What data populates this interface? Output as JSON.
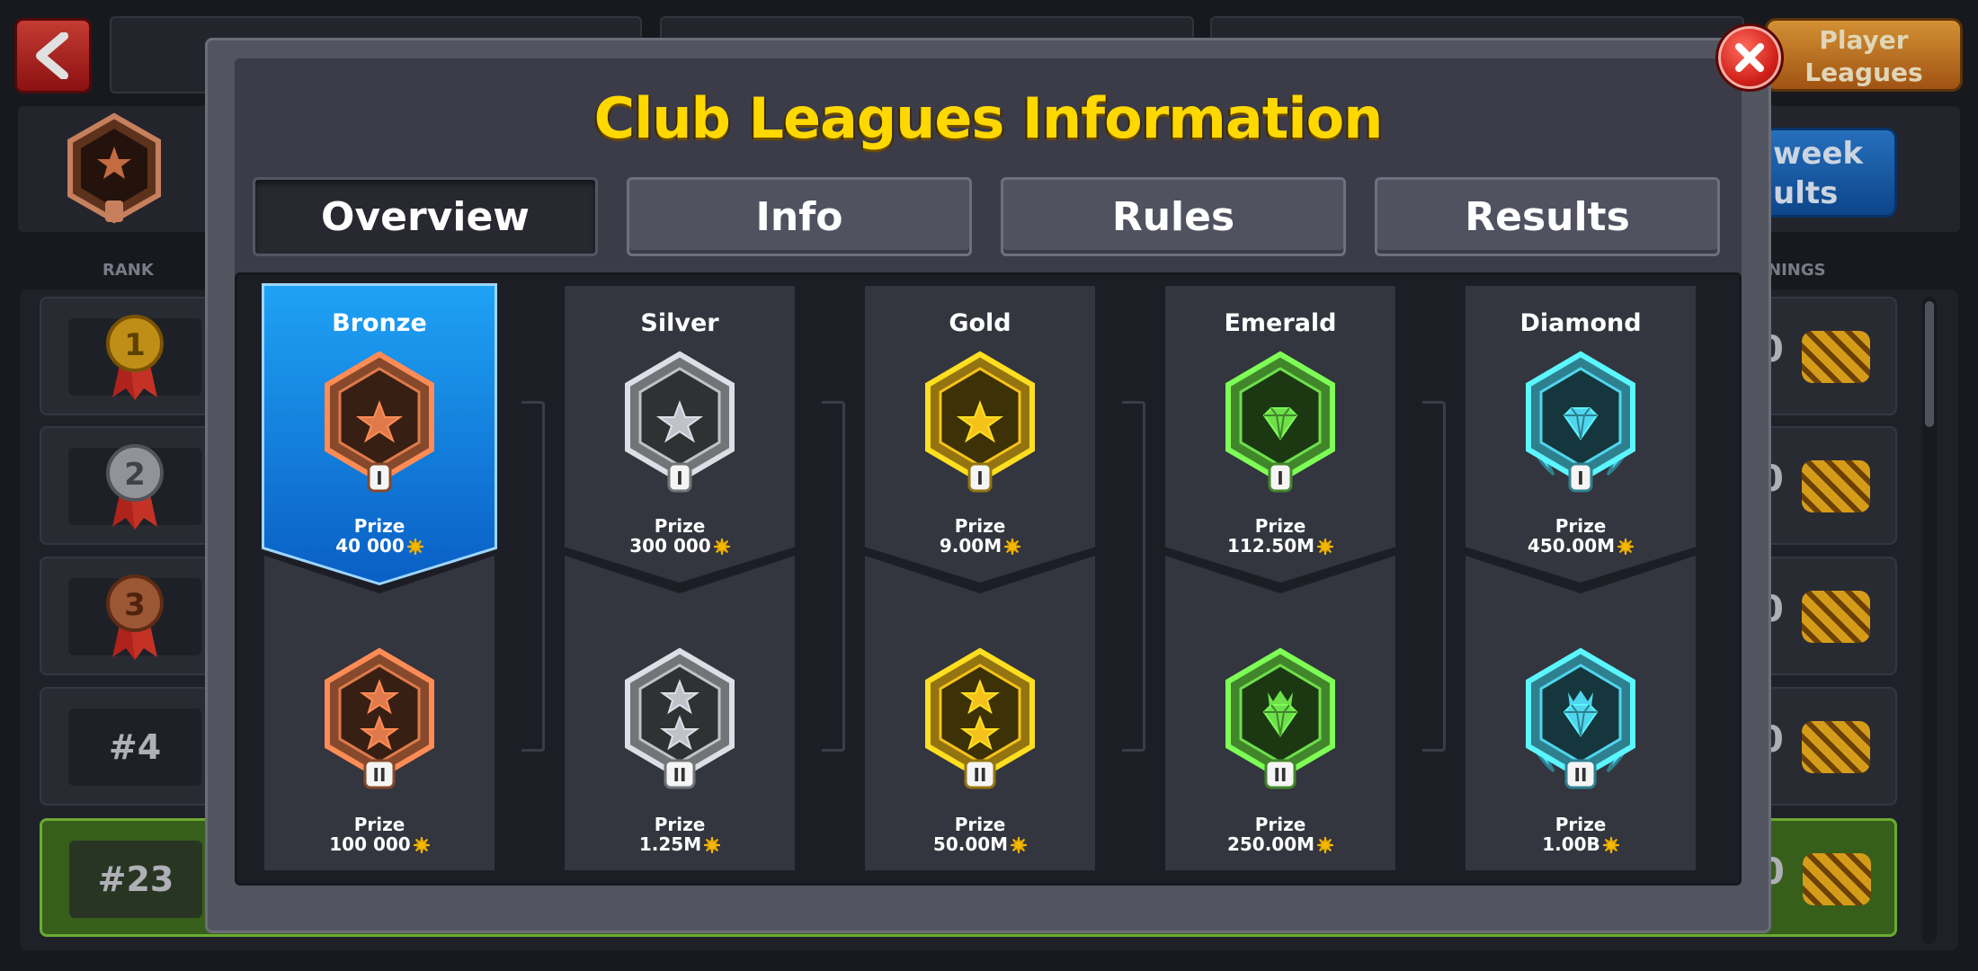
{
  "background": {
    "player_leagues_label": "Player\nLeagues",
    "last_week_label": "week\nults",
    "column_rank": "RANK",
    "column_winnings": "NINGS",
    "rows": [
      {
        "rank": "1",
        "tail": "0"
      },
      {
        "rank": "2",
        "tail": "0"
      },
      {
        "rank": "3",
        "tail": "0"
      },
      {
        "rank": "#4",
        "tail": "0"
      },
      {
        "rank": "#23",
        "tail": "0",
        "highlight": true
      }
    ]
  },
  "modal": {
    "title": "Club Leagues Information",
    "tabs": [
      "Overview",
      "Info",
      "Rules",
      "Results"
    ],
    "active_tab": "Overview",
    "prize_label": "Prize",
    "leagues": [
      {
        "name": "Bronze",
        "color": "#e07a4a",
        "tier1_prize": "40 000",
        "tier2_prize": "100 000",
        "tier1_roman": "I",
        "tier2_roman": "II",
        "icon": "star",
        "active": true
      },
      {
        "name": "Silver",
        "color": "#bfc2c8",
        "tier1_prize": "300 000",
        "tier2_prize": "1.25M",
        "tier1_roman": "I",
        "tier2_roman": "II",
        "icon": "star"
      },
      {
        "name": "Gold",
        "color": "#f5c21b",
        "tier1_prize": "9.00M",
        "tier2_prize": "50.00M",
        "tier1_roman": "I",
        "tier2_roman": "II",
        "icon": "star"
      },
      {
        "name": "Emerald",
        "color": "#6ee04a",
        "tier1_prize": "112.50M",
        "tier2_prize": "250.00M",
        "tier1_roman": "I",
        "tier2_roman": "II",
        "icon": "gem"
      },
      {
        "name": "Diamond",
        "color": "#4fd6ee",
        "tier1_prize": "450.00M",
        "tier2_prize": "1.00B",
        "tier1_roman": "I",
        "tier2_roman": "II",
        "icon": "diamond"
      }
    ]
  },
  "colors": {
    "title": "#ffd800",
    "active_league": "#0a7be0"
  }
}
